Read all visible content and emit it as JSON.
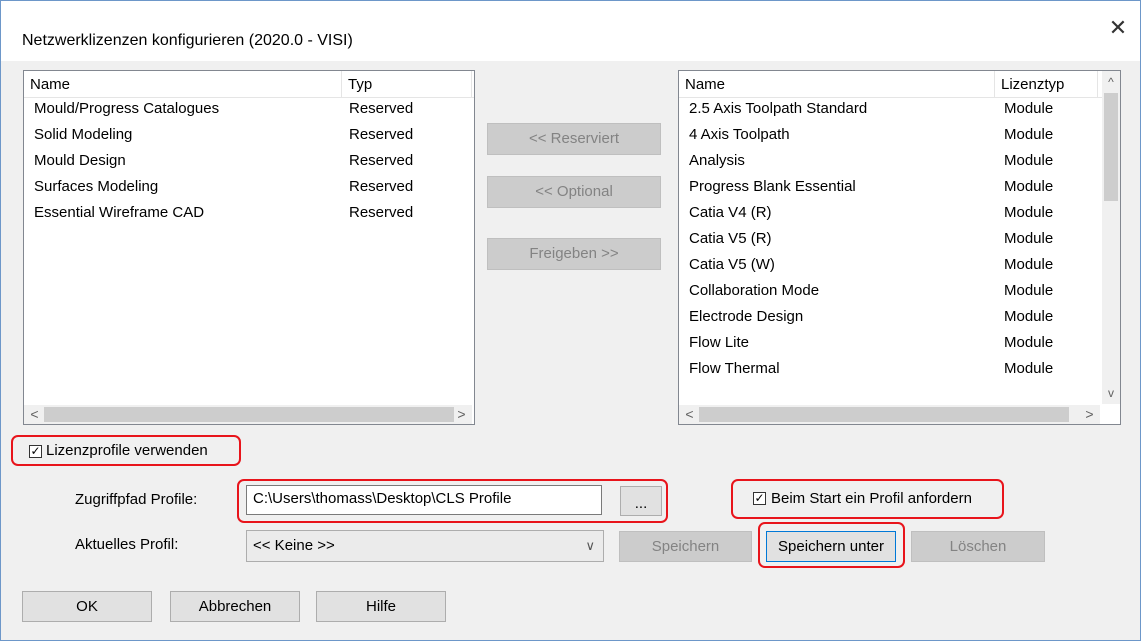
{
  "window": {
    "title": "Netzwerklizenzen konfigurieren (2020.0 - VISI)",
    "close_glyph": "✕"
  },
  "left_list": {
    "headers": {
      "name": "Name",
      "type": "Typ"
    },
    "rows": [
      {
        "name": "Mould/Progress Catalogues",
        "type": "Reserved"
      },
      {
        "name": "Solid Modeling",
        "type": "Reserved"
      },
      {
        "name": "Mould Design",
        "type": "Reserved"
      },
      {
        "name": "Surfaces Modeling",
        "type": "Reserved"
      },
      {
        "name": "Essential Wireframe CAD",
        "type": "Reserved"
      }
    ]
  },
  "right_list": {
    "headers": {
      "name": "Name",
      "type": "Lizenztyp"
    },
    "rows": [
      {
        "name": "2.5 Axis Toolpath Standard",
        "type": "Module"
      },
      {
        "name": "4 Axis Toolpath",
        "type": "Module"
      },
      {
        "name": "Analysis",
        "type": "Module"
      },
      {
        "name": "Progress Blank Essential",
        "type": "Module"
      },
      {
        "name": "Catia V4 (R)",
        "type": "Module"
      },
      {
        "name": "Catia V5 (R)",
        "type": "Module"
      },
      {
        "name": "Catia V5 (W)",
        "type": "Module"
      },
      {
        "name": "Collaboration Mode",
        "type": "Module"
      },
      {
        "name": "Electrode Design",
        "type": "Module"
      },
      {
        "name": "Flow Lite",
        "type": "Module"
      },
      {
        "name": "Flow Thermal",
        "type": "Module"
      }
    ]
  },
  "transfer_buttons": {
    "reserve": "<< Reserviert",
    "optional": "<< Optional",
    "release": "Freigeben >>"
  },
  "profiles": {
    "use_profiles_label": "Lizenzprofile verwenden",
    "use_profiles_checked": true,
    "path_label": "Zugriffpfad Profile:",
    "path_value": "C:\\Users\\thomass\\Desktop\\CLS Profile",
    "browse_label": "...",
    "request_on_start_label": "Beim Start ein Profil anfordern",
    "request_on_start_checked": true,
    "current_label": "Aktuelles Profil:",
    "current_value": "<< Keine >>",
    "save_label": "Speichern",
    "save_as_label": "Speichern unter",
    "delete_label": "Löschen"
  },
  "footer": {
    "ok": "OK",
    "cancel": "Abbrechen",
    "help": "Hilfe"
  },
  "icons": {
    "check": "✓",
    "scroll_left": "<",
    "scroll_right": ">",
    "scroll_up": "^",
    "scroll_down": "v",
    "chevron_down": "∨"
  },
  "colors": {
    "highlight": "#e8141b",
    "focus": "#0078d7",
    "border": "#6d97c9"
  }
}
